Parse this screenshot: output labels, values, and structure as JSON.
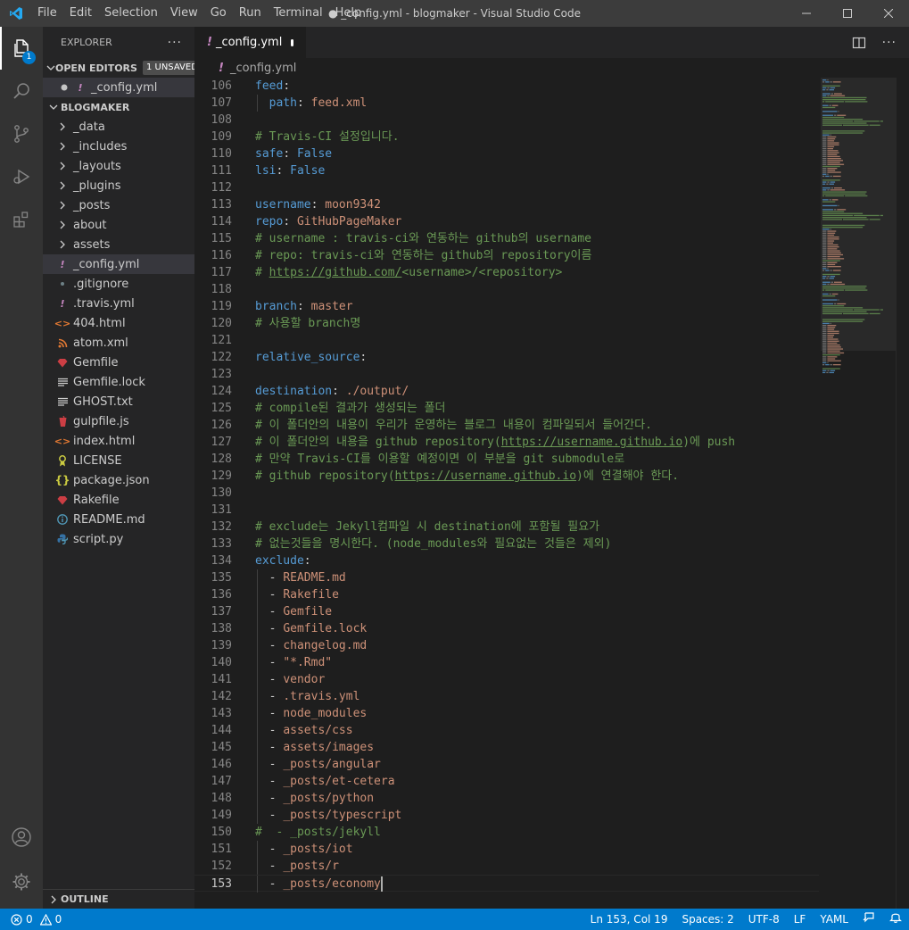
{
  "titlebar": {
    "menus": [
      "File",
      "Edit",
      "Selection",
      "View",
      "Go",
      "Run",
      "Terminal",
      "Help"
    ],
    "window_title": "● _config.yml - blogmaker - Visual Studio Code"
  },
  "activitybar": {
    "explorer_badge": "1"
  },
  "sidebar": {
    "title": "EXPLORER",
    "open_editors": {
      "label": "OPEN EDITORS",
      "badge": "1 UNSAVED",
      "files": [
        {
          "name": "_config.yml",
          "icon": "yaml-icon"
        }
      ]
    },
    "project": {
      "label": "BLOGMAKER",
      "items": [
        {
          "name": "_data",
          "type": "folder"
        },
        {
          "name": "_includes",
          "type": "folder"
        },
        {
          "name": "_layouts",
          "type": "folder"
        },
        {
          "name": "_plugins",
          "type": "folder"
        },
        {
          "name": "_posts",
          "type": "folder"
        },
        {
          "name": "about",
          "type": "folder"
        },
        {
          "name": "assets",
          "type": "folder"
        },
        {
          "name": "_config.yml",
          "type": "file",
          "icon": "yaml-icon",
          "selected": true
        },
        {
          "name": ".gitignore",
          "type": "file",
          "icon": "git-icon"
        },
        {
          "name": ".travis.yml",
          "type": "file",
          "icon": "yaml-icon"
        },
        {
          "name": "404.html",
          "type": "file",
          "icon": "html-icon"
        },
        {
          "name": "atom.xml",
          "type": "file",
          "icon": "rss-icon"
        },
        {
          "name": "Gemfile",
          "type": "file",
          "icon": "ruby-icon"
        },
        {
          "name": "Gemfile.lock",
          "type": "file",
          "icon": "lines-icon"
        },
        {
          "name": "GHOST.txt",
          "type": "file",
          "icon": "lines-icon"
        },
        {
          "name": "gulpfile.js",
          "type": "file",
          "icon": "gulp-icon"
        },
        {
          "name": "index.html",
          "type": "file",
          "icon": "html-icon"
        },
        {
          "name": "LICENSE",
          "type": "file",
          "icon": "license-icon"
        },
        {
          "name": "package.json",
          "type": "file",
          "icon": "json-icon"
        },
        {
          "name": "Rakefile",
          "type": "file",
          "icon": "ruby-icon"
        },
        {
          "name": "README.md",
          "type": "file",
          "icon": "info-icon"
        },
        {
          "name": "script.py",
          "type": "file",
          "icon": "python-icon"
        }
      ]
    },
    "outline": "OUTLINE"
  },
  "editor": {
    "tab": {
      "name": "_config.yml"
    },
    "breadcrumb": "_config.yml",
    "current_line": 153,
    "lines": [
      {
        "n": "106",
        "tokens": [
          [
            "k",
            "feed"
          ],
          [
            "p",
            ":"
          ]
        ]
      },
      {
        "n": "107",
        "tokens": [
          [
            "p",
            "  "
          ],
          [
            "k",
            "path"
          ],
          [
            "p",
            ": "
          ],
          [
            "s",
            "feed.xml"
          ]
        ]
      },
      {
        "n": "108",
        "tokens": []
      },
      {
        "n": "109",
        "tokens": [
          [
            "c",
            "# Travis-CI 설정입니다."
          ]
        ]
      },
      {
        "n": "110",
        "tokens": [
          [
            "k",
            "safe"
          ],
          [
            "p",
            ": "
          ],
          [
            "k",
            "False"
          ]
        ]
      },
      {
        "n": "111",
        "tokens": [
          [
            "k",
            "lsi"
          ],
          [
            "p",
            ": "
          ],
          [
            "k",
            "False"
          ]
        ]
      },
      {
        "n": "112",
        "tokens": []
      },
      {
        "n": "113",
        "tokens": [
          [
            "k",
            "username"
          ],
          [
            "p",
            ": "
          ],
          [
            "s",
            "moon9342"
          ]
        ]
      },
      {
        "n": "114",
        "tokens": [
          [
            "k",
            "repo"
          ],
          [
            "p",
            ": "
          ],
          [
            "s",
            "GitHubPageMaker"
          ]
        ]
      },
      {
        "n": "115",
        "tokens": [
          [
            "c",
            "# username : travis-ci와 연동하는 github의 username"
          ]
        ]
      },
      {
        "n": "116",
        "tokens": [
          [
            "c",
            "# repo: travis-ci와 연동하는 github의 repository이름"
          ]
        ]
      },
      {
        "n": "117",
        "tokens": [
          [
            "c",
            "# "
          ],
          [
            "u",
            "https://github.com/"
          ],
          [
            "c",
            "<username>/<repository>"
          ]
        ]
      },
      {
        "n": "118",
        "tokens": []
      },
      {
        "n": "119",
        "tokens": [
          [
            "k",
            "branch"
          ],
          [
            "p",
            ": "
          ],
          [
            "s",
            "master"
          ]
        ]
      },
      {
        "n": "120",
        "tokens": [
          [
            "c",
            "# 사용할 branch명"
          ]
        ]
      },
      {
        "n": "121",
        "tokens": []
      },
      {
        "n": "122",
        "tokens": [
          [
            "k",
            "relative_source"
          ],
          [
            "p",
            ":"
          ]
        ]
      },
      {
        "n": "123",
        "tokens": []
      },
      {
        "n": "124",
        "tokens": [
          [
            "k",
            "destination"
          ],
          [
            "p",
            ": "
          ],
          [
            "s",
            "./output/"
          ]
        ]
      },
      {
        "n": "125",
        "tokens": [
          [
            "c",
            "# compile된 결과가 생성되는 폴더"
          ]
        ]
      },
      {
        "n": "126",
        "tokens": [
          [
            "c",
            "# 이 폴더안의 내용이 우리가 운영하는 블로그 내용이 컴파일되서 들어간다."
          ]
        ]
      },
      {
        "n": "127",
        "tokens": [
          [
            "c",
            "# 이 폴더안의 내용을 github repository("
          ],
          [
            "u",
            "https://username.github.io"
          ],
          [
            "c",
            ")에 push"
          ]
        ]
      },
      {
        "n": "128",
        "tokens": [
          [
            "c",
            "# 만약 Travis-CI를 이용할 예정이면 이 부분을 git submodule로"
          ]
        ]
      },
      {
        "n": "129",
        "tokens": [
          [
            "c",
            "# github repository("
          ],
          [
            "u",
            "https://username.github.io"
          ],
          [
            "c",
            ")에 연결해야 한다."
          ]
        ]
      },
      {
        "n": "130",
        "tokens": []
      },
      {
        "n": "131",
        "tokens": []
      },
      {
        "n": "132",
        "tokens": [
          [
            "c",
            "# exclude는 Jekyll컴파일 시 destination에 포함될 필요가"
          ]
        ]
      },
      {
        "n": "133",
        "tokens": [
          [
            "c",
            "# 없는것들을 명시한다. (node_modules와 필요없는 것들은 제외)"
          ]
        ]
      },
      {
        "n": "134",
        "tokens": [
          [
            "k",
            "exclude"
          ],
          [
            "p",
            ":"
          ]
        ]
      },
      {
        "n": "135",
        "tokens": [
          [
            "p",
            "  - "
          ],
          [
            "s",
            "README.md"
          ]
        ]
      },
      {
        "n": "136",
        "tokens": [
          [
            "p",
            "  - "
          ],
          [
            "s",
            "Rakefile"
          ]
        ]
      },
      {
        "n": "137",
        "tokens": [
          [
            "p",
            "  - "
          ],
          [
            "s",
            "Gemfile"
          ]
        ]
      },
      {
        "n": "138",
        "tokens": [
          [
            "p",
            "  - "
          ],
          [
            "s",
            "Gemfile.lock"
          ]
        ]
      },
      {
        "n": "139",
        "tokens": [
          [
            "p",
            "  - "
          ],
          [
            "s",
            "changelog.md"
          ]
        ]
      },
      {
        "n": "140",
        "tokens": [
          [
            "p",
            "  - "
          ],
          [
            "s",
            "\"*.Rmd\""
          ]
        ]
      },
      {
        "n": "141",
        "tokens": [
          [
            "p",
            "  - "
          ],
          [
            "s",
            "vendor"
          ]
        ]
      },
      {
        "n": "142",
        "tokens": [
          [
            "p",
            "  - "
          ],
          [
            "s",
            ".travis.yml"
          ]
        ]
      },
      {
        "n": "143",
        "tokens": [
          [
            "p",
            "  - "
          ],
          [
            "s",
            "node_modules"
          ]
        ]
      },
      {
        "n": "144",
        "tokens": [
          [
            "p",
            "  - "
          ],
          [
            "s",
            "assets/css"
          ]
        ]
      },
      {
        "n": "145",
        "tokens": [
          [
            "p",
            "  - "
          ],
          [
            "s",
            "assets/images"
          ]
        ]
      },
      {
        "n": "146",
        "tokens": [
          [
            "p",
            "  - "
          ],
          [
            "s",
            "_posts/angular"
          ]
        ]
      },
      {
        "n": "147",
        "tokens": [
          [
            "p",
            "  - "
          ],
          [
            "s",
            "_posts/et-cetera"
          ]
        ]
      },
      {
        "n": "148",
        "tokens": [
          [
            "p",
            "  - "
          ],
          [
            "s",
            "_posts/python"
          ]
        ]
      },
      {
        "n": "149",
        "tokens": [
          [
            "p",
            "  - "
          ],
          [
            "s",
            "_posts/typescript"
          ]
        ]
      },
      {
        "n": "150",
        "tokens": [
          [
            "c",
            "#  - _posts/jekyll"
          ]
        ]
      },
      {
        "n": "151",
        "tokens": [
          [
            "p",
            "  - "
          ],
          [
            "s",
            "_posts/iot"
          ]
        ]
      },
      {
        "n": "152",
        "tokens": [
          [
            "p",
            "  - "
          ],
          [
            "s",
            "_posts/r"
          ]
        ]
      },
      {
        "n": "153",
        "tokens": [
          [
            "p",
            "  - "
          ],
          [
            "s",
            "_posts/economy"
          ]
        ]
      }
    ]
  },
  "statusbar": {
    "errors": "0",
    "warnings": "0",
    "position": "Ln 153, Col 19",
    "indent": "Spaces: 2",
    "encoding": "UTF-8",
    "eol": "LF",
    "language": "YAML"
  },
  "colors": {
    "accent": "#007acc",
    "keyword": "#569cd6",
    "string": "#ce9178",
    "comment": "#6a9955"
  }
}
